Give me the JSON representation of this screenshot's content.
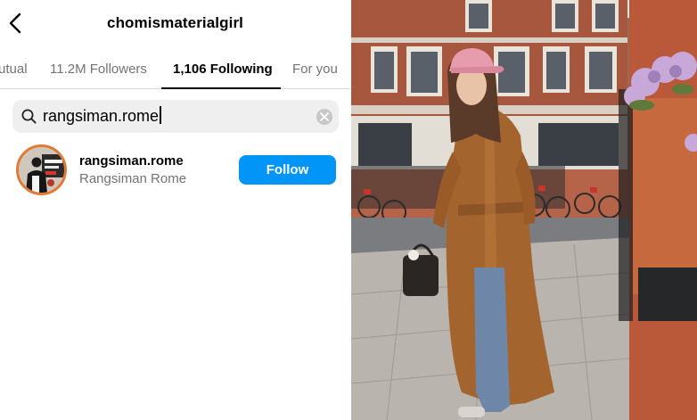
{
  "header": {
    "username": "chomismaterialgirl",
    "back_icon": "chevron-left-icon"
  },
  "tabs": [
    {
      "label": "utual",
      "active": false
    },
    {
      "label": "11.2M Followers",
      "active": false
    },
    {
      "label": "1,106 Following",
      "active": true
    },
    {
      "label": "For you",
      "active": false
    }
  ],
  "search": {
    "value": "rangsiman.rome",
    "icon": "search-icon",
    "clear_icon": "clear-icon"
  },
  "results": [
    {
      "username": "rangsiman.rome",
      "full_name": "Rangsiman Rome",
      "button_label": "Follow",
      "avatar_icon": "profile-photo"
    }
  ],
  "colors": {
    "follow_button": "#0095f6",
    "story_ring": "#e07a34",
    "muted_text": "#737373",
    "search_bg": "#efefef"
  },
  "photo": {
    "subject": "street-photo"
  }
}
